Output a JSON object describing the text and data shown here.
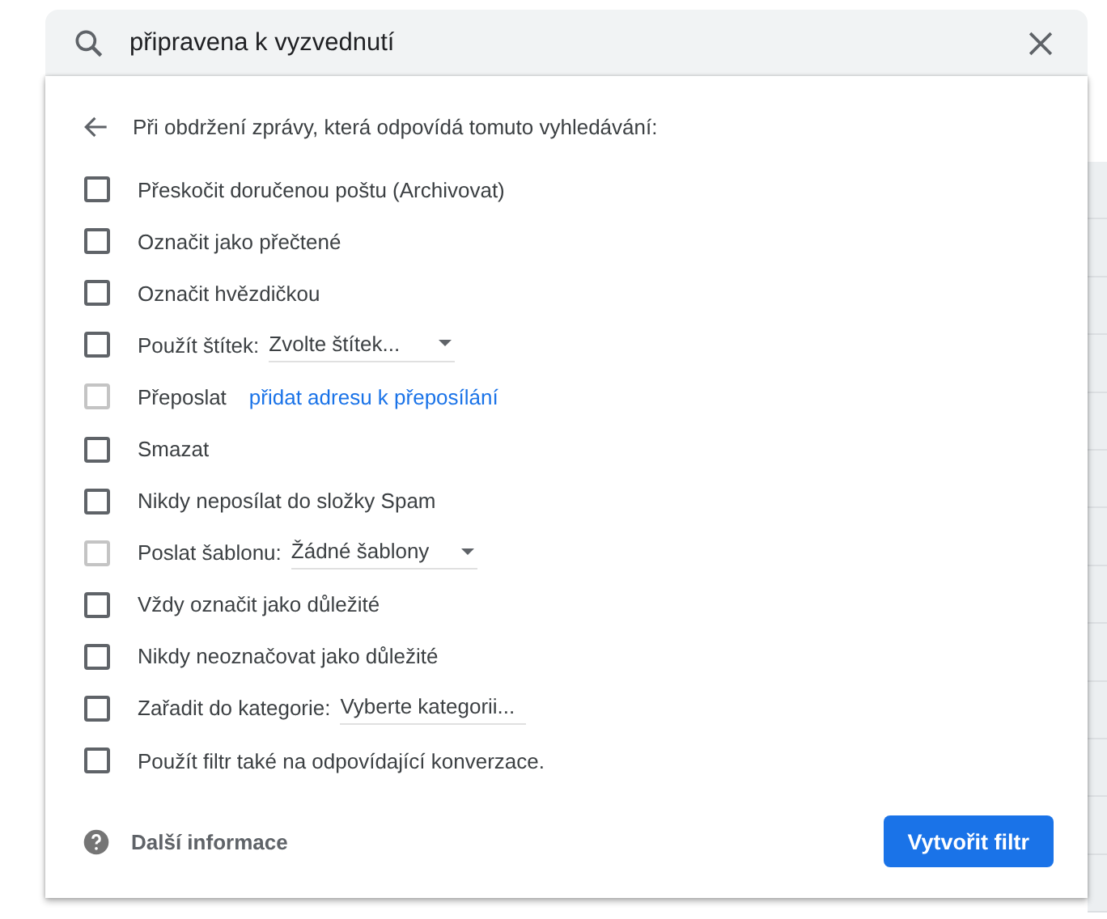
{
  "search": {
    "value": "připravena k vyzvednutí"
  },
  "filter": {
    "heading": "Při obdržení zprávy, která odpovídá tomuto vyhledávání:",
    "options": [
      {
        "kind": "plain",
        "label": "Přeskočit doručenou poštu (Archivovat)",
        "checked": false,
        "disabled": false
      },
      {
        "kind": "plain",
        "label": "Označit jako přečtené",
        "checked": false,
        "disabled": false
      },
      {
        "kind": "plain",
        "label": "Označit hvězdičkou",
        "checked": false,
        "disabled": false
      },
      {
        "kind": "select",
        "label": "Použít štítek:",
        "value": "Zvolte štítek...",
        "checked": false,
        "disabled": false
      },
      {
        "kind": "link",
        "label": "Přeposlat",
        "link": "přidat adresu k přeposílání",
        "checked": false,
        "disabled": true
      },
      {
        "kind": "plain",
        "label": "Smazat",
        "checked": false,
        "disabled": false
      },
      {
        "kind": "plain",
        "label": "Nikdy neposílat do složky Spam",
        "checked": false,
        "disabled": false
      },
      {
        "kind": "select",
        "label": "Poslat šablonu:",
        "value": "Žádné šablony",
        "checked": false,
        "disabled": true
      },
      {
        "kind": "plain",
        "label": "Vždy označit jako důležité",
        "checked": false,
        "disabled": false
      },
      {
        "kind": "plain",
        "label": "Nikdy neoznačovat jako důležité",
        "checked": false,
        "disabled": false
      },
      {
        "kind": "select",
        "label": "Zařadit do kategorie:",
        "value": "Vyberte kategorii...",
        "checked": false,
        "disabled": false
      },
      {
        "kind": "plain",
        "label": "Použít filtr také na odpovídající konverzace.",
        "checked": false,
        "disabled": false
      }
    ],
    "help": "Další informace",
    "create_button": "Vytvořit filtr"
  }
}
